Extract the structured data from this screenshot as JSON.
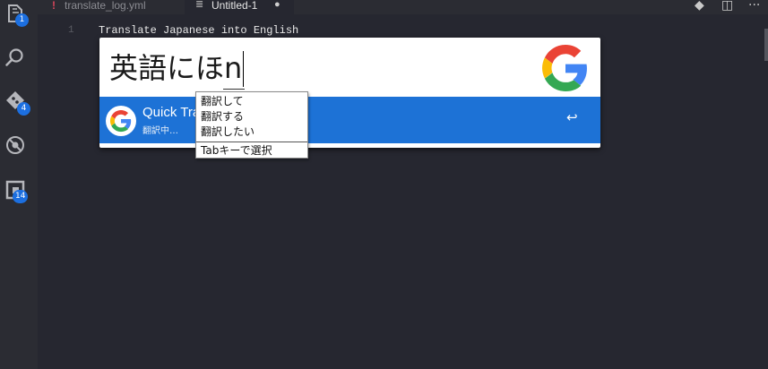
{
  "activity_bar": {
    "items": [
      {
        "icon": "files-icon",
        "badge": "1"
      },
      {
        "icon": "search-icon",
        "badge": ""
      },
      {
        "icon": "source-control-icon",
        "badge": "4"
      },
      {
        "icon": "debug-icon",
        "badge": ""
      },
      {
        "icon": "extensions-icon",
        "badge": "14"
      }
    ]
  },
  "tabs": [
    {
      "label": "translate_log.yml",
      "icon": "yaml-file-icon",
      "active": false
    },
    {
      "label": "Untitled-1",
      "icon": "text-file-icon",
      "active": true,
      "dirty_marker": "●"
    }
  ],
  "tab_actions": {
    "git_icon": "git-compare-icon",
    "split_icon": "split-editor-icon",
    "more_icon": "more-icon",
    "more_label": "···"
  },
  "editor": {
    "line_number": "1",
    "line_text": "Translate Japanese into English"
  },
  "quick_translate": {
    "input_value": "英語にほn",
    "result_title": "Quick Translate",
    "result_subtitle": "翻訳中…",
    "enter_glyph": "↩",
    "accent_color": "#1d72d6"
  },
  "ime": {
    "candidates": [
      "翻訳して",
      "翻訳する",
      "翻訳したい"
    ],
    "footer": "Tabキーで選択"
  }
}
